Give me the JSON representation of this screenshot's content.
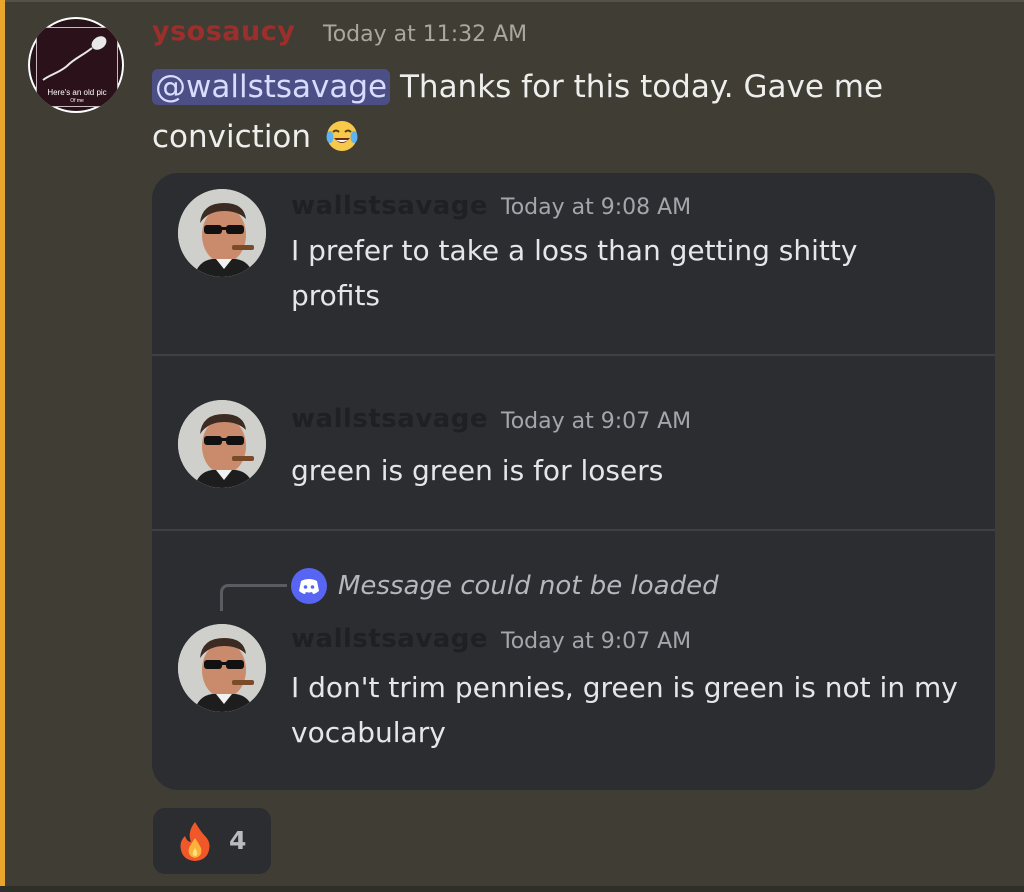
{
  "message": {
    "author": "ysosaucy",
    "timestamp": "Today at 11:32 AM",
    "avatar_caption": "Here's an old pic",
    "avatar_subcaption": "Of me",
    "mention": "@wallstsavage",
    "text_line1": " Thanks for this today. Gave me",
    "text_line2": "conviction ",
    "emoji": "joy-emoji"
  },
  "embedded_messages": [
    {
      "author": "wallstsavage",
      "timestamp": "Today at 9:08 AM",
      "line1": "I prefer to take a loss than getting shitty",
      "line2": "profits"
    },
    {
      "author": "wallstsavage",
      "timestamp": "Today at 9:07 AM",
      "line1": "green is green is for losers",
      "line2": ""
    },
    {
      "author": "wallstsavage",
      "timestamp": "Today at 9:07 AM",
      "reply_notice": "Message could not be loaded",
      "line1": "I don't trim pennies, green is green is not in my",
      "line2": "vocabulary"
    }
  ],
  "reaction": {
    "emoji": "fire-emoji",
    "count": "4"
  },
  "colors": {
    "background": "#403d35",
    "accent_bar": "#e8a72c",
    "author_name": "#9c2f2c",
    "mention_bg": "#4c4f85",
    "embed_bg": "#2b2d31",
    "discord_blurple": "#5865f2"
  }
}
